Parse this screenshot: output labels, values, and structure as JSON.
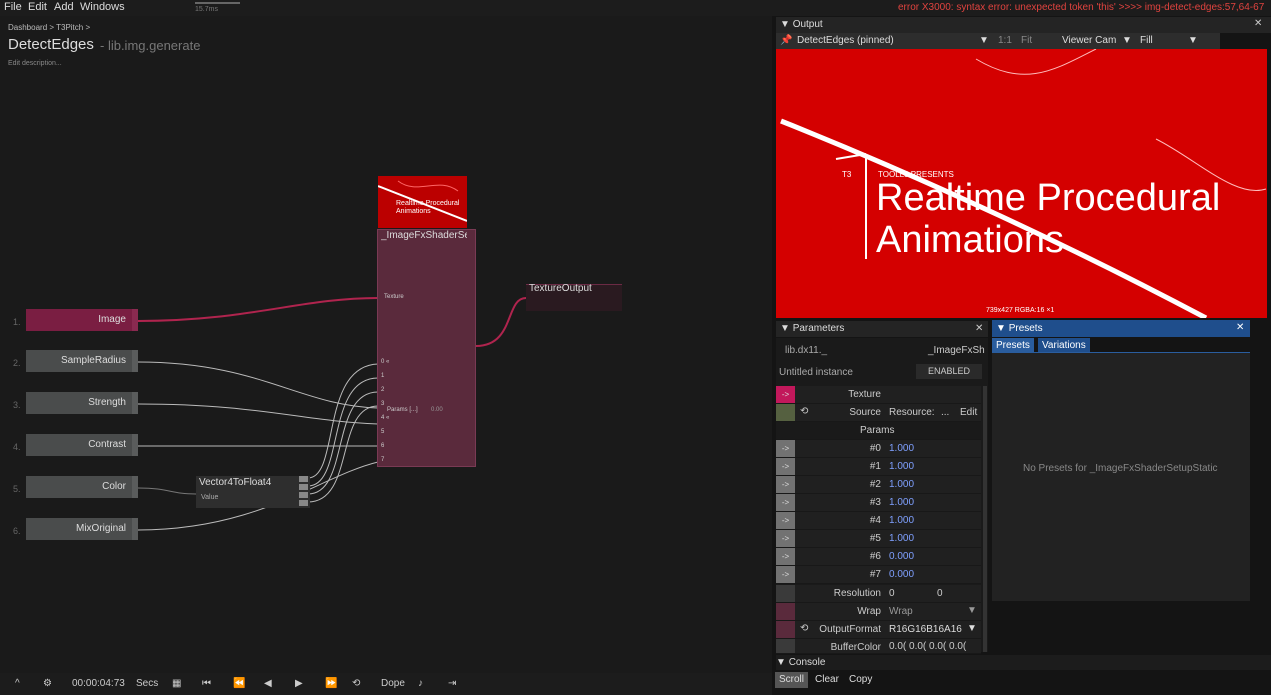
{
  "menu": [
    "File",
    "Edit",
    "Add",
    "Windows"
  ],
  "fps_label": "15.7ms",
  "error_message": "error X3000: syntax error: unexpected token 'this' >>>> img-detect-edges:57,64-67",
  "breadcrumb": "Dashboard  >  T3Pitch  >",
  "graph_title": "DetectEdges",
  "graph_namespace": "- lib.img.generate",
  "graph_description": "Edit description...",
  "inputs": [
    {
      "index": "1.",
      "label": "Image"
    },
    {
      "index": "2.",
      "label": "SampleRadius"
    },
    {
      "index": "3.",
      "label": "Strength"
    },
    {
      "index": "4.",
      "label": "Contrast"
    },
    {
      "index": "5.",
      "label": "Color"
    },
    {
      "index": "6.",
      "label": "MixOriginal"
    }
  ],
  "shader_node": {
    "title": "_ImageFxShaderSe",
    "thumb_line1": "Realtime Procedural",
    "thumb_line2": "Animations",
    "texture_slot": "Texture",
    "params_slot": "Params [...]",
    "params_value": "0.00",
    "slot_indices": [
      "0 «",
      "1",
      "2",
      "3",
      "4 «",
      "5",
      "6",
      "7"
    ]
  },
  "texture_output": "TextureOutput",
  "vec4_node": {
    "title": "Vector4ToFloat4",
    "value_label": "Value"
  },
  "transport": {
    "time": "00:00:04:73",
    "unit": "Secs",
    "mode": "Dope"
  },
  "output": {
    "panel_title": "Output",
    "selected": "DetectEdges (pinned)",
    "ratio": "1:1",
    "fit": "Fit",
    "camera": "Viewer Cam",
    "fill": "Fill",
    "big_line1": "Realtime Procedural",
    "big_line2": "Animations",
    "small_header": "TOOLL3 PRESENTS",
    "t3": "T3",
    "info": "739x427  RGBA:16  ×1"
  },
  "parameters": {
    "panel_title": "Parameters",
    "symbol": "lib.dx11._",
    "symbol_right": "_ImageFxSh",
    "instance": "Untitled instance",
    "enabled": "ENABLED",
    "texture_label": "Texture",
    "source_label": "Source",
    "source_value": "Resource:",
    "source_dots": "...",
    "source_edit": "Edit",
    "params_header": "Params",
    "params": [
      {
        "name": "#0",
        "value": "1.000"
      },
      {
        "name": "#1",
        "value": "1.000"
      },
      {
        "name": "#2",
        "value": "1.000"
      },
      {
        "name": "#3",
        "value": "1.000"
      },
      {
        "name": "#4",
        "value": "1.000"
      },
      {
        "name": "#5",
        "value": "1.000"
      },
      {
        "name": "#6",
        "value": "0.000"
      },
      {
        "name": "#7",
        "value": "0.000"
      }
    ],
    "resolution_label": "Resolution",
    "resolution_x": "0",
    "resolution_y": "0",
    "wrap_label": "Wrap",
    "wrap_value": "Wrap",
    "format_label": "OutputFormat",
    "format_value": "R16G16B16A16",
    "buffer_label": "BufferColor",
    "buffer_value": "0.0( 0.0( 0.0( 0.0("
  },
  "presets": {
    "panel_title": "Presets",
    "tabs": [
      "Presets",
      "Variations"
    ],
    "empty_message": "No Presets for _ImageFxShaderSetupStatic"
  },
  "console": {
    "panel_title": "Console",
    "buttons": [
      "Scroll",
      "Clear",
      "Copy"
    ]
  },
  "colors": {
    "accent": "#d40000",
    "image_node": "#7a1e42",
    "shader_node": "#5a2a3c",
    "presets_header": "#1f4e8c"
  }
}
